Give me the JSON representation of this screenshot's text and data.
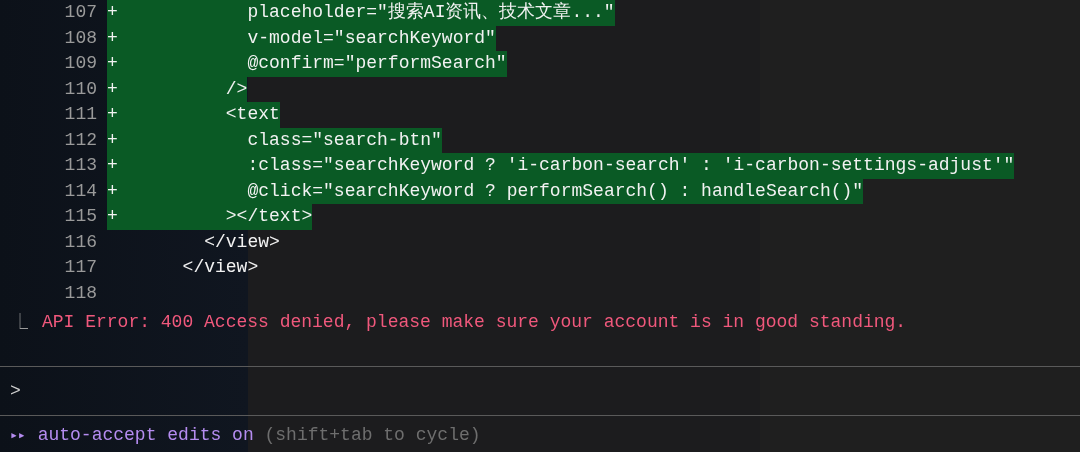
{
  "diff_lines": [
    {
      "number": "107",
      "marker": "+",
      "added": true,
      "code": "            placeholder=\"搜索AI资讯、技术文章...\""
    },
    {
      "number": "108",
      "marker": "+",
      "added": true,
      "code": "            v-model=\"searchKeyword\""
    },
    {
      "number": "109",
      "marker": "+",
      "added": true,
      "code": "            @confirm=\"performSearch\""
    },
    {
      "number": "110",
      "marker": "+",
      "added": true,
      "code": "          />"
    },
    {
      "number": "111",
      "marker": "+",
      "added": true,
      "code": "          <text"
    },
    {
      "number": "112",
      "marker": "+",
      "added": true,
      "code": "            class=\"search-btn\""
    },
    {
      "number": "113",
      "marker": "+",
      "added": true,
      "code": "            :class=\"searchKeyword ? 'i-carbon-search' : 'i-carbon-settings-adjust'\""
    },
    {
      "number": "114",
      "marker": "+",
      "added": true,
      "code": "            @click=\"searchKeyword ? performSearch() : handleSearch()\""
    },
    {
      "number": "115",
      "marker": "+",
      "added": true,
      "code": "          ></text>"
    },
    {
      "number": "116",
      "added": false,
      "code": "        </view>"
    },
    {
      "number": "117",
      "added": false,
      "code": "      </view>"
    },
    {
      "number": "118"
    }
  ],
  "error": {
    "icon": "⎿",
    "message": "API Error: 400 Access denied, please make sure your account is in good standing."
  },
  "prompt": {
    "symbol": ">"
  },
  "mode_bar": {
    "icon": "▸▸",
    "label": "auto-accept edits on",
    "hint": "(shift+tab to cycle)"
  }
}
